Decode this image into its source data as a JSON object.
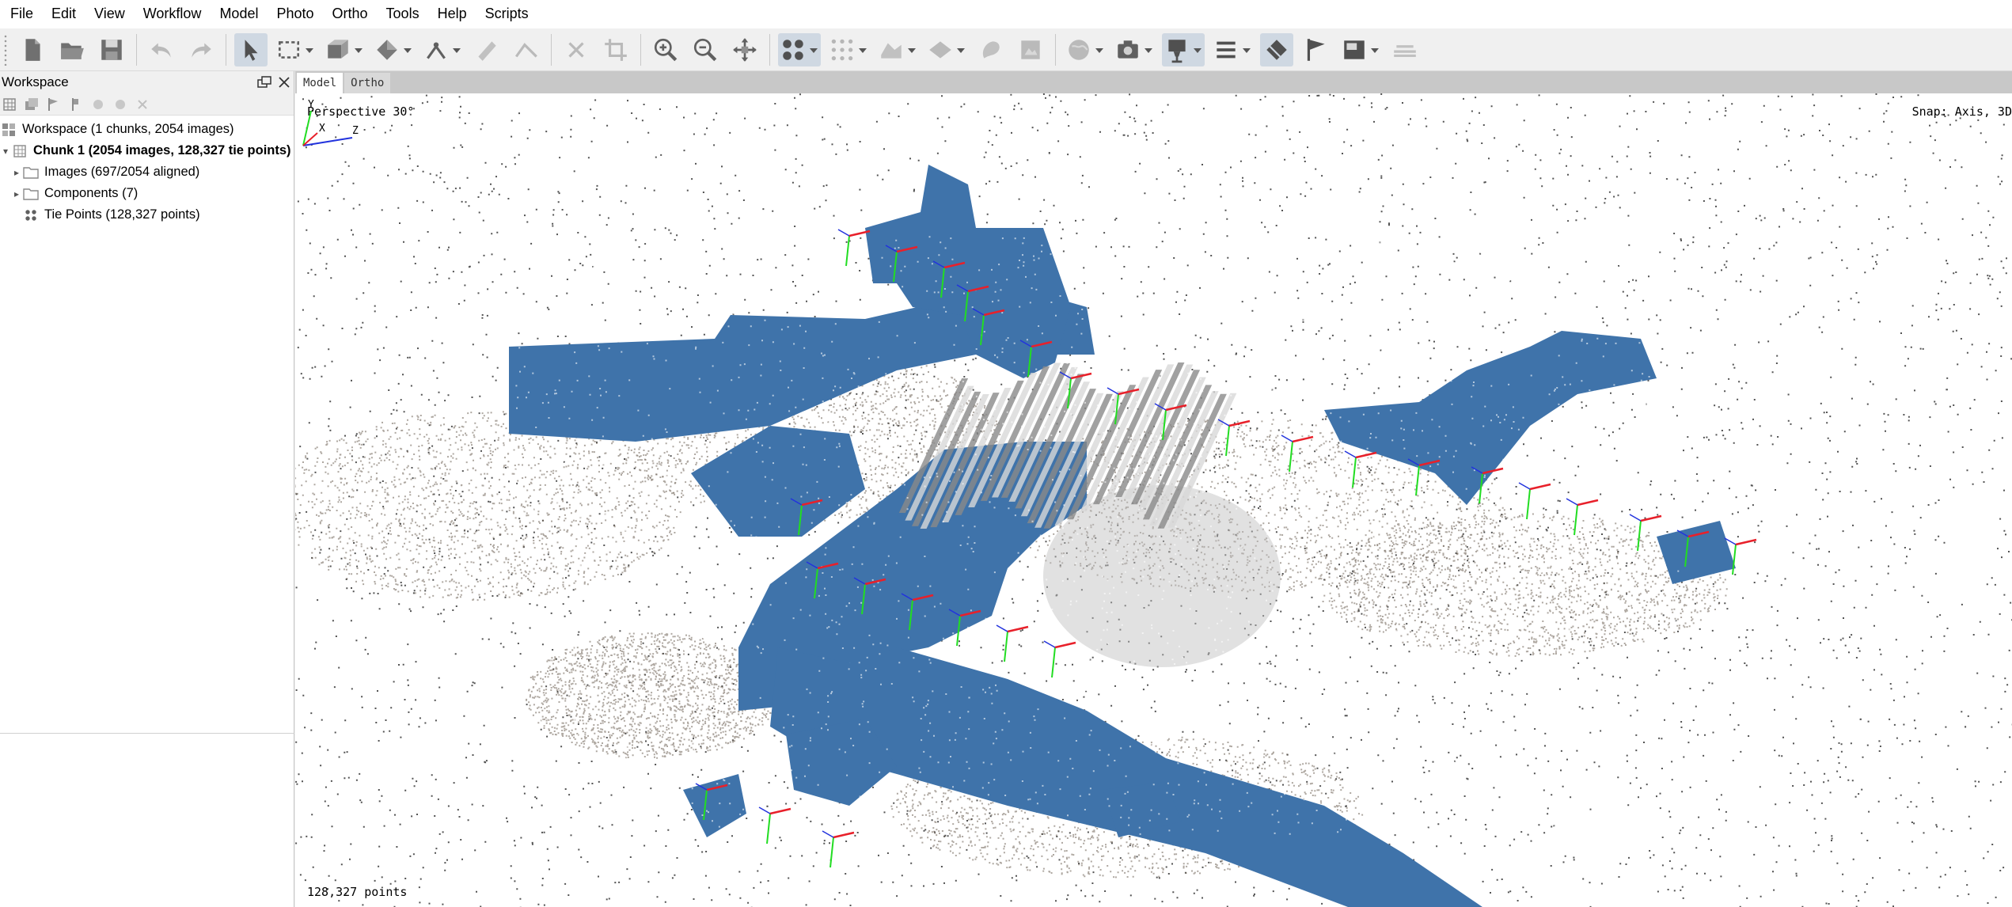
{
  "menu": [
    "File",
    "Edit",
    "View",
    "Workflow",
    "Model",
    "Photo",
    "Ortho",
    "Tools",
    "Help",
    "Scripts"
  ],
  "toolbar_icons": [
    "new-icon",
    "open-icon",
    "save-icon",
    "undo-icon",
    "redo-icon",
    "navigation-icon",
    "rectangle-selection-icon",
    "resize-region-icon",
    "rotate-region-icon",
    "ruler-icon",
    "draw-polygon-icon",
    "draw-polyline-icon",
    "delete-selection-icon",
    "crop-icon",
    "zoom-in-icon",
    "zoom-out-icon",
    "reset-view-icon",
    "show-tie-points-icon",
    "show-dense-cloud-icon",
    "show-model-icon",
    "show-tiled-model-icon",
    "show-dem-icon",
    "show-orthomosaic-icon",
    "show-shapes-icon",
    "camera-icon",
    "show-cameras-icon",
    "show-region-icon",
    "show-markers-icon",
    "flag-icon",
    "show-images-icon",
    "layers-icon"
  ],
  "workspace": {
    "title": "Workspace",
    "root": "Workspace (1 chunks, 2054 images)",
    "chunk": "Chunk 1 (2054 images, 128,327 tie points)",
    "items": [
      {
        "label": "Images (697/2054 aligned)",
        "icon": "folder-icon",
        "expandable": true
      },
      {
        "label": "Components (7)",
        "icon": "folder-icon",
        "expandable": true
      },
      {
        "label": "Tie Points (128,327 points)",
        "icon": "tie-points-icon",
        "expandable": false
      }
    ]
  },
  "viewport": {
    "tabs": [
      "Model",
      "Ortho"
    ],
    "active_tab": "Model",
    "view_mode": "Perspective 30°",
    "snap": "Snap: Axis, 3D",
    "point_count": "128,327 points",
    "axis_labels": [
      "Y",
      "X",
      "Z"
    ]
  },
  "colors": {
    "camera_plane": "#3f73aa",
    "axis_x": "#e8202a",
    "axis_y": "#22dd22",
    "axis_z": "#2233dd",
    "tie_point": "#1a1a1a"
  }
}
